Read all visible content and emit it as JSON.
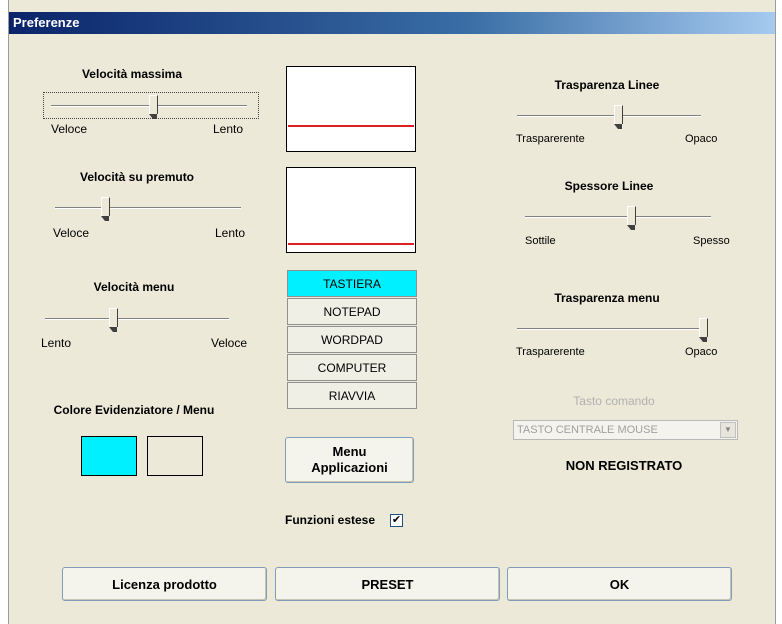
{
  "window": {
    "title": "Preferenze"
  },
  "sliders": {
    "max_speed": {
      "title": "Velocità massima",
      "left_label": "Veloce",
      "right_label": "Lento",
      "value": 0.52
    },
    "pressed_speed": {
      "title": "Velocità su premuto",
      "left_label": "Veloce",
      "right_label": "Lento",
      "value": 0.27
    },
    "menu_speed": {
      "title": "Velocità menu",
      "left_label": "Lento",
      "right_label": "Veloce",
      "value": 0.37
    },
    "line_transparency": {
      "title": "Trasparenza Linee",
      "left_label": "Trasparerente",
      "right_label": "Opaco",
      "value": 0.55
    },
    "line_thickness": {
      "title": "Spessore Linee",
      "left_label": "Sottile",
      "right_label": "Spesso",
      "value": 0.57
    },
    "menu_transparency": {
      "title": "Trasparenza menu",
      "left_label": "Trasparerente",
      "right_label": "Opaco",
      "value": 1.0
    }
  },
  "color_section": {
    "title": "Colore Evidenziatore / Menu",
    "highlight_color": "#00f0ff",
    "menu_color": "#ece9d8"
  },
  "app_list": {
    "items": [
      {
        "label": "TASTIERA",
        "selected": true
      },
      {
        "label": "NOTEPAD",
        "selected": false
      },
      {
        "label": "WORDPAD",
        "selected": false
      },
      {
        "label": "COMPUTER",
        "selected": false
      },
      {
        "label": "RIAVVIA",
        "selected": false
      }
    ],
    "selected_color": "#00f0ff"
  },
  "menu_apps_button": {
    "line1": "Menu",
    "line2": "Applicazioni"
  },
  "extended_functions": {
    "label": "Funzioni estese",
    "checked": true
  },
  "command_key": {
    "title": "Tasto comando",
    "value": "TASTO CENTRALE MOUSE"
  },
  "registration_status": "NON REGISTRATO",
  "footer": {
    "license_label": "Licenza prodotto",
    "preset_label": "PRESET",
    "ok_label": "OK"
  },
  "icons": {
    "checkmark": "check-icon",
    "dropdown": "chevron-down-icon"
  }
}
